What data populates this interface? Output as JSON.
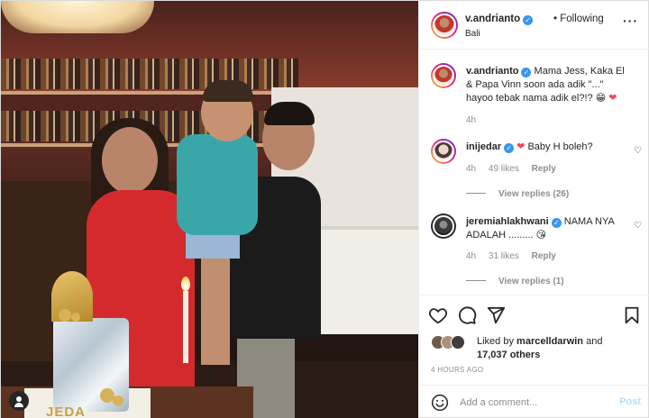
{
  "post": {
    "photo": {
      "cake_text": "JEDA",
      "tag_icon": "user-tag-icon"
    }
  },
  "header": {
    "username": "v.andrianto",
    "separator": "•",
    "follow_label": "Following",
    "location": "Bali",
    "more_icon": "more-horizontal-icon"
  },
  "caption": {
    "username": "v.andrianto",
    "text": "Mama Jess, Kaka El & Papa Vinn soon ada adik \"...\" hayoo tebak nama adik el?!?",
    "emoji": "😁",
    "heart": "❤",
    "time": "4h"
  },
  "comments": [
    {
      "username": "inijedar",
      "heart": "❤",
      "text": "Baby H boleh?",
      "time": "4h",
      "likes": "49 likes",
      "reply_label": "Reply",
      "view_replies": "View replies (26)"
    },
    {
      "username": "jeremiahlakhwani",
      "text": "NAMA NYA ADALAH .........",
      "emoji": "😘",
      "time": "4h",
      "likes": "31 likes",
      "reply_label": "Reply",
      "view_replies": "View replies (1)"
    }
  ],
  "actions": {
    "like_icon": "heart-icon",
    "comment_icon": "comment-icon",
    "share_icon": "share-icon",
    "save_icon": "bookmark-icon"
  },
  "likes": {
    "prefix": "Liked by",
    "user": "marcelldarwin",
    "and": "and",
    "others": "17,037 others"
  },
  "time_ago": "4 HOURS AGO",
  "add_comment": {
    "placeholder": "Add a comment...",
    "post_label": "Post",
    "emoji_icon": "smile-icon"
  },
  "colors": {
    "verified": "#3897f0",
    "heart": "#ed4956",
    "post_disabled": "#b2dffc",
    "meta_text": "#8e8e8e"
  }
}
